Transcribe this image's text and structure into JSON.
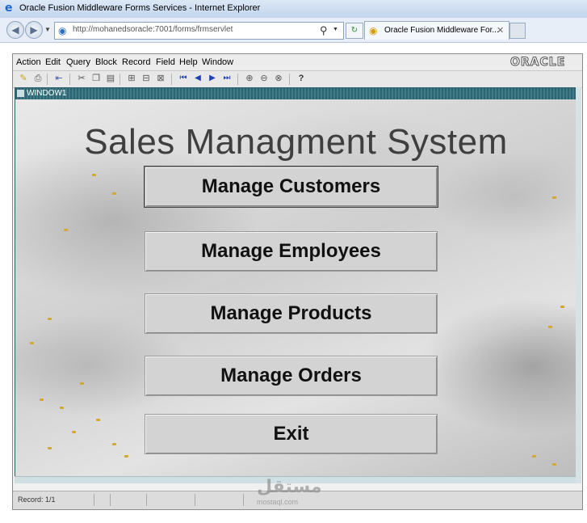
{
  "browser": {
    "window_title": "Oracle Fusion Middleware Forms Services - Internet Explorer",
    "url": "http://mohanedsoracle:7001/forms/frmservlet",
    "tab_label": "Oracle Fusion Middleware For...",
    "icons": [
      "ie-logo-icon",
      "back-icon",
      "forward-icon",
      "page-icon",
      "search-icon",
      "refresh-icon",
      "tab-icon",
      "close-icon"
    ]
  },
  "forms": {
    "menu": [
      "Action",
      "Edit",
      "Query",
      "Block",
      "Record",
      "Field",
      "Help",
      "Window"
    ],
    "brand": "ORACLE",
    "window_label": "WINDOW1",
    "toolbar_help": "?",
    "status": "Record: 1/1"
  },
  "app": {
    "title": "Sales Managment System",
    "buttons": {
      "customers": "Manage Customers",
      "employees": "Manage Employees",
      "products": "Manage Products",
      "orders": "Manage Orders",
      "exit": "Exit"
    },
    "focused_button": "customers"
  },
  "watermark": {
    "text": "مستقل",
    "sub": "mostaql.com"
  }
}
